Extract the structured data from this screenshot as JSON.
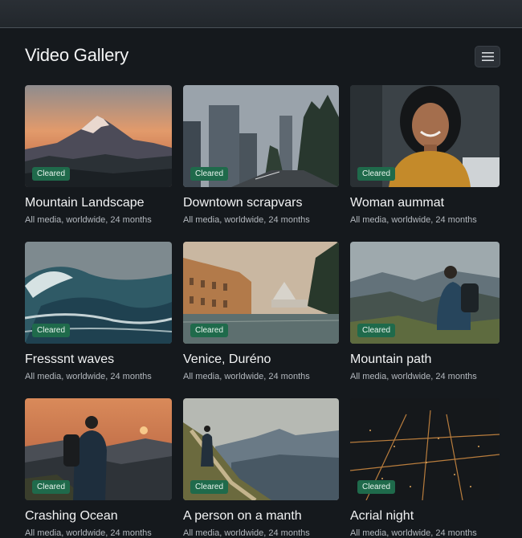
{
  "header": {
    "title": "Video Gallery",
    "menu_icon": "hamburger-menu-icon"
  },
  "colors": {
    "background": "#15191d",
    "badge": "#1f6a4b",
    "meta_text": "#b4b9bf"
  },
  "cards": [
    {
      "title": "Mountain Landscape",
      "meta": "All media, worldwide, 24 months",
      "badge": "Cleared",
      "image": "mountain-sunset"
    },
    {
      "title": "Downtown scrapvars",
      "meta": "All media, worldwide, 24 months",
      "badge": "Cleared",
      "image": "city-skyscrapers"
    },
    {
      "title": "Woman aummat",
      "meta": "All media, worldwide, 24 months",
      "badge": "Cleared",
      "image": "smiling-woman"
    },
    {
      "title": "Fresssnt waves",
      "meta": "All media, worldwide, 24 months",
      "badge": "Cleared",
      "image": "ocean-wave"
    },
    {
      "title": "Venice, Duréno",
      "meta": "All media, worldwide, 24 months",
      "badge": "Cleared",
      "image": "venice-canal"
    },
    {
      "title": "Mountain path",
      "meta": "All media, worldwide, 24 months",
      "badge": "Cleared",
      "image": "hiker-valley"
    },
    {
      "title": "Crashing Ocean",
      "meta": "All media, worldwide, 24 months",
      "badge": "Cleared",
      "image": "hiker-sunset"
    },
    {
      "title": "A person on a manth",
      "meta": "All media, worldwide, 24 months",
      "badge": "Cleared",
      "image": "hiker-ridge"
    },
    {
      "title": "Acrial night",
      "meta": "All media, worldwide, 24 months",
      "badge": "Cleared",
      "image": "aerial-city-night"
    }
  ]
}
